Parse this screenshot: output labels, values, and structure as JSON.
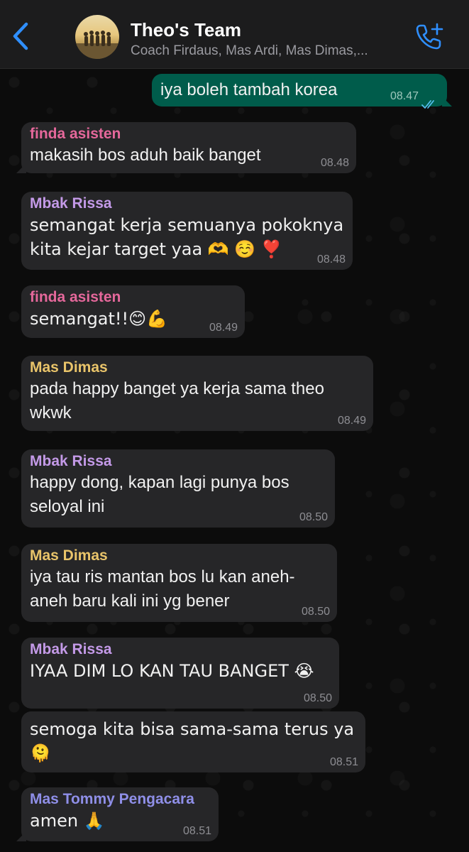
{
  "header": {
    "title": "Theo's Team",
    "subtitle": "Coach Firdaus, Mas Ardi, Mas Dimas,...",
    "back_icon": "chevron-left-icon",
    "call_icon": "phone-add-icon"
  },
  "colors": {
    "accent": "#2f8fff",
    "incoming_bubble": "#262628",
    "outgoing_bubble": "#005c4b",
    "finda_asisten": "#e5689b",
    "mbak_rissa": "#c49ae8",
    "mas_dimas": "#e9c46a",
    "mas_tommy": "#8f8fe8"
  },
  "messages": [
    {
      "direction": "out",
      "text": "iya boleh tambah korea",
      "time": "08.47",
      "status": "read"
    },
    {
      "direction": "in",
      "sender": "finda asisten",
      "text": "makasih bos aduh baik banget",
      "time": "08.48"
    },
    {
      "direction": "in",
      "sender": "Mbak Rissa",
      "text": "semangat kerja semuanya pokoknya\nkita kejar target yaa 🫶 ☺️ ❣️",
      "time": "08.48"
    },
    {
      "direction": "in",
      "sender": "finda asisten",
      "text": "semangat!!😊💪",
      "time": "08.49"
    },
    {
      "direction": "in",
      "sender": "Mas Dimas",
      "text": "pada happy banget ya kerja sama theo\nwkwk",
      "time": "08.49"
    },
    {
      "direction": "in",
      "sender": "Mbak Rissa",
      "text": "happy dong, kapan lagi punya bos\nseloyal ini",
      "time": "08.50"
    },
    {
      "direction": "in",
      "sender": "Mas Dimas",
      "text": "iya tau ris mantan bos lu kan aneh-\naneh baru kali ini yg bener",
      "time": "08.50"
    },
    {
      "direction": "in",
      "sender": "Mbak Rissa",
      "text": "IYAA DIM LO KAN TAU BANGET 😭",
      "time": "08.50"
    },
    {
      "direction": "in",
      "text": "semoga kita bisa sama-sama terus ya\n🫠",
      "time": "08.51"
    },
    {
      "direction": "in",
      "sender": "Mas Tommy Pengacara",
      "text": "amen 🙏",
      "time": "08.51"
    }
  ]
}
